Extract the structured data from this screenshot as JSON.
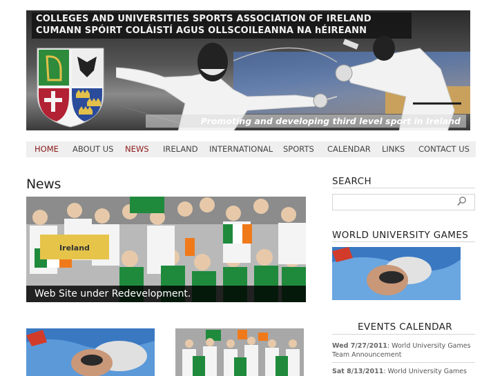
{
  "header": {
    "title_en": "COLLEGES AND UNIVERSITIES SPORTS ASSOCIATION OF IRELAND",
    "title_ga": "CUMANN SPÓIRT COLÁISTÍ AGUS OLLSCOILEANNA NA hÉIREANN",
    "tagline": "Promoting and developing third level sport in Ireland"
  },
  "nav": {
    "items": [
      {
        "label": "HOME",
        "active": true
      },
      {
        "label": "ABOUT US",
        "active": false
      },
      {
        "label": "NEWS",
        "active": true
      },
      {
        "label": "IRELAND",
        "active": false
      },
      {
        "label": "INTERNATIONAL",
        "active": false
      },
      {
        "label": "SPORTS",
        "active": false
      },
      {
        "label": "CALENDAR",
        "active": false
      },
      {
        "label": "LINKS",
        "active": false
      },
      {
        "label": "CONTACT US",
        "active": false
      }
    ]
  },
  "main": {
    "heading": "News",
    "feature_caption": "Web Site under Redevelopment.",
    "feature_sign_text": "Ireland"
  },
  "sidebar": {
    "search_heading": "SEARCH",
    "search_placeholder": "",
    "wug_heading": "WORLD UNIVERSITY GAMES",
    "events_heading": "EVENTS CALENDAR",
    "events": [
      {
        "date": "Wed 7/27/2011",
        "title": ": World University Games Team Announcement"
      },
      {
        "date": "Sat 8/13/2011",
        "title": ": World University Games"
      }
    ]
  },
  "colors": {
    "nav_active": "#8b1a1a",
    "nav_bg": "#efefef",
    "caption_bg": "#000000",
    "irish_green": "#1f8a3c",
    "irish_orange": "#f07a1a"
  }
}
